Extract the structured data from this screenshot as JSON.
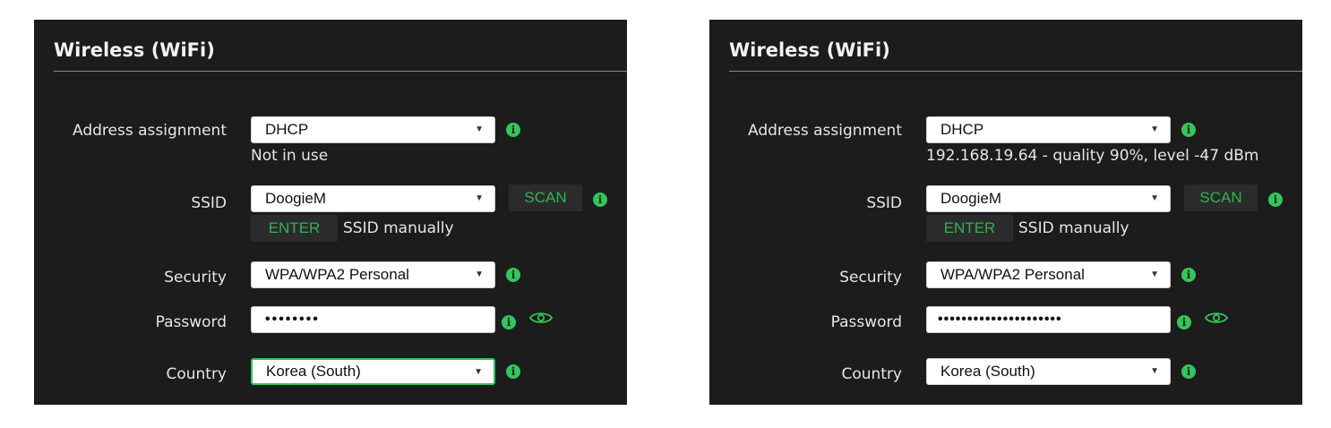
{
  "colors": {
    "panel_bg": "#1c1c1c",
    "accent": "#36c45c",
    "button_bg": "#2b2b2b",
    "label": "#e6e6e6"
  },
  "panels": [
    {
      "title": "Wireless (WiFi)",
      "address": {
        "label": "Address assignment",
        "value": "DHCP",
        "status": "Not in use"
      },
      "ssid": {
        "label": "SSID",
        "value": "DoogieM",
        "scan_label": "SCAN",
        "enter_label": "ENTER",
        "enter_suffix": "SSID manually"
      },
      "security": {
        "label": "Security",
        "value": "WPA/WPA2 Personal"
      },
      "password": {
        "label": "Password",
        "value": "••••••••"
      },
      "country": {
        "label": "Country",
        "value": "Korea (South)"
      }
    },
    {
      "title": "Wireless (WiFi)",
      "address": {
        "label": "Address assignment",
        "value": "DHCP",
        "status": "192.168.19.64 - quality 90%, level -47 dBm"
      },
      "ssid": {
        "label": "SSID",
        "value": "DoogieM",
        "scan_label": "SCAN",
        "enter_label": "ENTER",
        "enter_suffix": "SSID manually"
      },
      "security": {
        "label": "Security",
        "value": "WPA/WPA2 Personal"
      },
      "password": {
        "label": "Password",
        "value": "•••••••••••••••••••••"
      },
      "country": {
        "label": "Country",
        "value": "Korea (South)"
      }
    }
  ],
  "icons": {
    "info": "info-icon",
    "eye": "eye-icon",
    "dropdown": "chevron-down-icon"
  }
}
